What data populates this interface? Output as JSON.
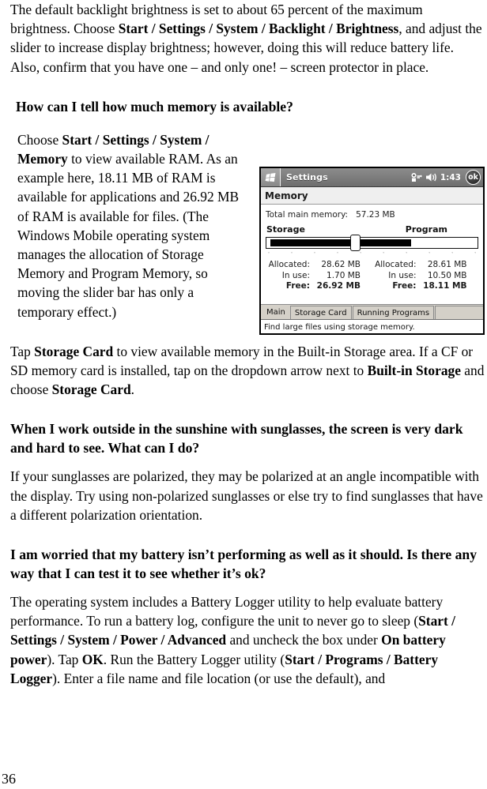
{
  "page": {
    "number": "36"
  },
  "sections": {
    "backlight_para": "The default backlight brightness is set to about 65 percent of the maximum brightness. Choose Start / Settings / System / Backlight / Brightness, and adjust the slider to increase display brightness; however, doing this will reduce battery life. Also, confirm that you have one – and only one! – screen protector in place.",
    "heading_memory": "How can I tell how much memory is available?",
    "memory_para": "Choose Start / Settings / System / Memory to view available RAM. As an example here, 18.11 MB of RAM is available for applications and 26.92 MB of RAM is available for files. (The Windows Mobile operating system manages the allocation of Storage Memory and Program Memory, so moving the slider bar has only a temporary effect.)",
    "storage_card_para": "Tap Storage Card to view available memory in the Built-in Storage area. If a CF or SD memory card is installed, tap on the dropdown arrow next to Built-in Storage and choose Storage Card.",
    "heading_sunglasses": "When I work outside in the sunshine with sunglasses, the screen is very dark and hard to see. What can I do?",
    "sunglasses_para": "If your sunglasses are polarized, they may be polarized at an angle incompatible with the display. Try using non-polarized sunglasses or else try to find sunglasses that have a different polarization orientation.",
    "heading_battery": "I am worried that my battery isn’t performing as well as it should. Is there any way that I can test it to see whether it’s ok?",
    "battery_para": "The operating system includes a Battery Logger utility to help evaluate battery performance. To run a battery log, configure the unit to never go to sleep (Start / Settings / System / Power / Advanced and uncheck the box under On battery power). Tap OK. Run the Battery Logger utility (Start / Programs / Battery Logger). Enter a file name and file location (or use the default), and"
  },
  "device_screenshot": {
    "titlebar": {
      "app_title": "Settings",
      "time": "1:43",
      "ok_label": "ok",
      "start_icon": "windows-flag-icon",
      "connectivity_icon": "connectivity-icon",
      "volume_icon": "speaker-icon"
    },
    "subtitle": "Memory",
    "total_memory_label": "Total main memory:",
    "total_memory_value": "57.23 MB",
    "slider": {
      "left_label": "Storage",
      "right_label": "Program"
    },
    "storage_column": {
      "allocated_label": "Allocated:",
      "allocated_value": "28.62 MB",
      "inuse_label": "In use:",
      "inuse_value": "1.70 MB",
      "free_label": "Free:",
      "free_value": "26.92 MB"
    },
    "program_column": {
      "allocated_label": "Allocated:",
      "allocated_value": "28.61 MB",
      "inuse_label": "In use:",
      "inuse_value": "10.50 MB",
      "free_label": "Free:",
      "free_value": "18.11 MB"
    },
    "tabs": [
      {
        "label": "Main",
        "active": true
      },
      {
        "label": "Storage Card",
        "active": false
      },
      {
        "label": "Running Programs",
        "active": false
      }
    ],
    "hint": "Find large files using storage memory.",
    "statusbar": {
      "keyboard_icon": "keyboard-icon",
      "arrow_icon": "chevron-up-icon"
    }
  }
}
